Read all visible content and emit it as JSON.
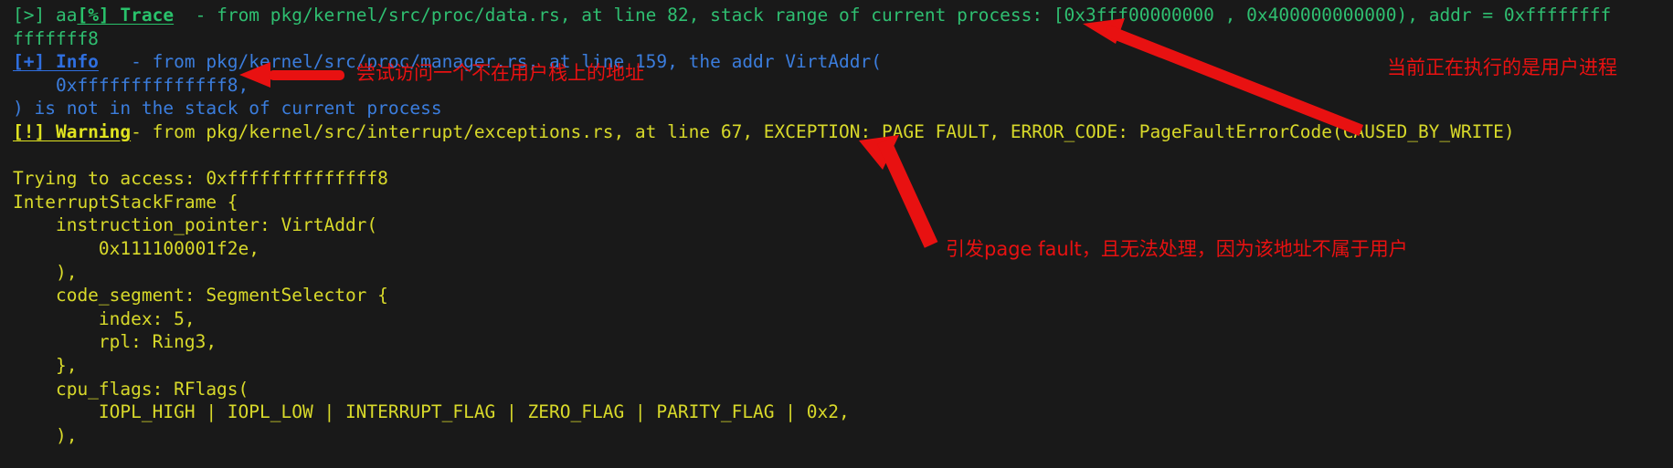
{
  "terminal": {
    "background": "#191919",
    "colors": {
      "trace": "#2fbf71",
      "info": "#3b7ddd",
      "warning": "#d8d92a",
      "annotation": "#e81111"
    },
    "lines": [
      {
        "id": "trace-line",
        "level": "trace",
        "prefix": "[>] aa",
        "badge": "[%] Trace",
        "text": "  - from pkg/kernel/src/proc/data.rs, at line 82, stack range of current process: [0x3fff00000000 , 0x400000000000), addr = 0xffffffff"
      },
      {
        "id": "trace-wrap-line",
        "level": "trace",
        "text": "fffffff8"
      },
      {
        "id": "info-line",
        "level": "info",
        "badge": "[+] Info",
        "text": "   - from pkg/kernel/src/proc/manager.rs, at line 159, the addr VirtAddr("
      },
      {
        "id": "info-addr-line",
        "level": "info",
        "text": "    0xffffffffffffff8,"
      },
      {
        "id": "info-tail-line",
        "level": "info",
        "text": ") is not in the stack of current process"
      },
      {
        "id": "warning-line",
        "level": "warning",
        "badge": "[!] Warning",
        "text": "- from pkg/kernel/src/interrupt/exceptions.rs, at line 67, EXCEPTION: PAGE FAULT, ERROR_CODE: PageFaultErrorCode(CAUSED_BY_WRITE)"
      },
      {
        "id": "blank-line-1",
        "level": "warning",
        "text": ""
      },
      {
        "id": "access-line",
        "level": "warning",
        "text": "Trying to access: 0xffffffffffffff8"
      },
      {
        "id": "frame-open-line",
        "level": "warning",
        "text": "InterruptStackFrame {"
      },
      {
        "id": "ip-line",
        "level": "warning",
        "text": "    instruction_pointer: VirtAddr("
      },
      {
        "id": "ip-value-line",
        "level": "warning",
        "text": "        0x111100001f2e,"
      },
      {
        "id": "ip-close-line",
        "level": "warning",
        "text": "    ),"
      },
      {
        "id": "cs-line",
        "level": "warning",
        "text": "    code_segment: SegmentSelector {"
      },
      {
        "id": "cs-index-line",
        "level": "warning",
        "text": "        index: 5,"
      },
      {
        "id": "cs-rpl-line",
        "level": "warning",
        "text": "        rpl: Ring3,"
      },
      {
        "id": "cs-close-line",
        "level": "warning",
        "text": "    },"
      },
      {
        "id": "rflags-line",
        "level": "warning",
        "text": "    cpu_flags: RFlags("
      },
      {
        "id": "rflags-value-line",
        "level": "warning",
        "text": "        IOPL_HIGH | IOPL_LOW | INTERRUPT_FLAG | ZERO_FLAG | PARITY_FLAG | 0x2,"
      },
      {
        "id": "rflags-close-line",
        "level": "warning",
        "text": "    ),"
      }
    ]
  },
  "annotations": [
    {
      "id": "annotation-user-process",
      "text": "当前正在执行的是用户进程"
    },
    {
      "id": "annotation-bad-address",
      "text": "尝试访问一个不在用户栈上的地址"
    },
    {
      "id": "annotation-page-fault",
      "text": "引发page fault，且无法处理，因为该地址不属于用户"
    }
  ]
}
